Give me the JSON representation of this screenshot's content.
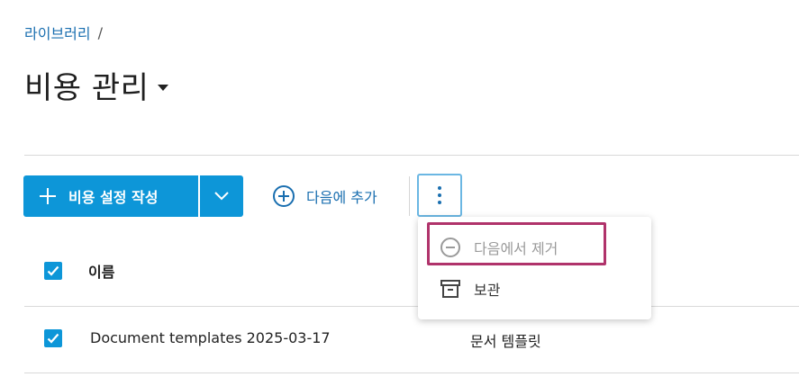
{
  "breadcrumb": {
    "library": "라이브러리",
    "separator": "/"
  },
  "page": {
    "title": "비용 관리"
  },
  "toolbar": {
    "create_label": "비용 설정 작성",
    "add_to_label": "다음에 추가"
  },
  "table": {
    "header_name": "이름",
    "rows": [
      {
        "name": "Document templates 2025-03-17",
        "type": "문서 템플릿",
        "checked": true
      }
    ]
  },
  "menu": {
    "remove_label": "다음에서 제거",
    "archive_label": "보관"
  },
  "colors": {
    "primary": "#0d96d8",
    "link": "#1a6fb0",
    "highlight": "#b0336b"
  }
}
